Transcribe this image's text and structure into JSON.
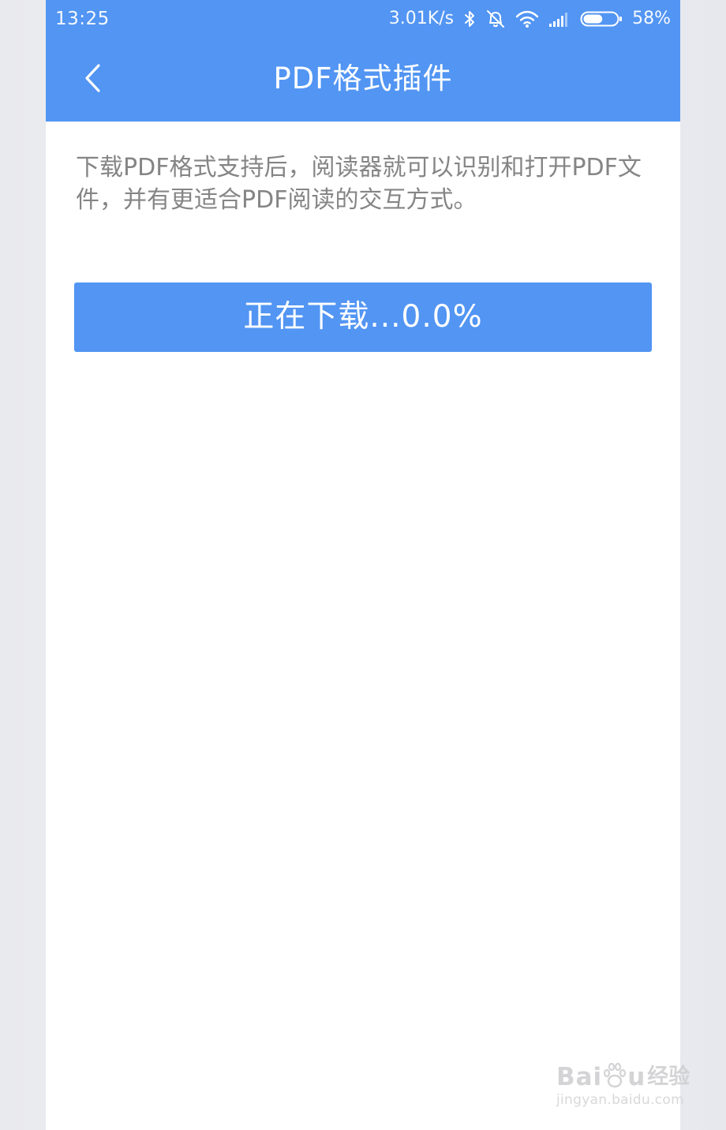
{
  "status_bar": {
    "time": "13:25",
    "network_speed": "3.01K/s",
    "battery_percent": "58%",
    "battery_level": 0.58,
    "icons": [
      "bluetooth-icon",
      "alarm-off-icon",
      "wifi-icon",
      "cellular-signal-icon",
      "battery-icon"
    ]
  },
  "header": {
    "back_icon": "chevron-left-icon",
    "title": "PDF格式插件"
  },
  "content": {
    "description": "下载PDF格式支持后，阅读器就可以识别和打开PDF文件，并有更适合PDF阅读的交互方式。",
    "download_button_label": "正在下载...0.0%",
    "download_progress_percent": 0.0
  },
  "watermark": {
    "brand_latin": "Bai",
    "brand_latin_2": "u",
    "brand_cn": "经验",
    "url": "jingyan.baidu.com"
  },
  "colors": {
    "accent": "#5295f3",
    "description_text": "#858585",
    "background": "#ffffff"
  }
}
